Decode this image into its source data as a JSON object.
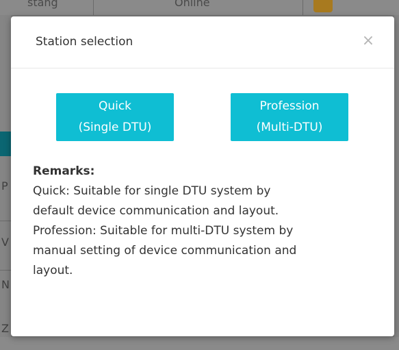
{
  "modal": {
    "title": "Station selection",
    "close_glyph": "×",
    "buttons": {
      "quick": {
        "line1": "Quick",
        "line2": "(Single DTU)"
      },
      "profession": {
        "line1": "Profession",
        "line2": "(Multi-DTU)"
      }
    },
    "remarks": {
      "title": "Remarks:",
      "lines": [
        "Quick: Suitable for single DTU system by",
        "default device communication and layout.",
        "Profession: Suitable for multi-DTU system by",
        "manual setting of device communication and",
        "layout."
      ]
    }
  },
  "background": {
    "top_left_text": "stang",
    "top_mid_text": "Online",
    "left_letters": [
      "P",
      "V",
      "N",
      "Z"
    ]
  },
  "colors": {
    "accent": "#0fbed3",
    "overlay": "#7a7a7a"
  }
}
